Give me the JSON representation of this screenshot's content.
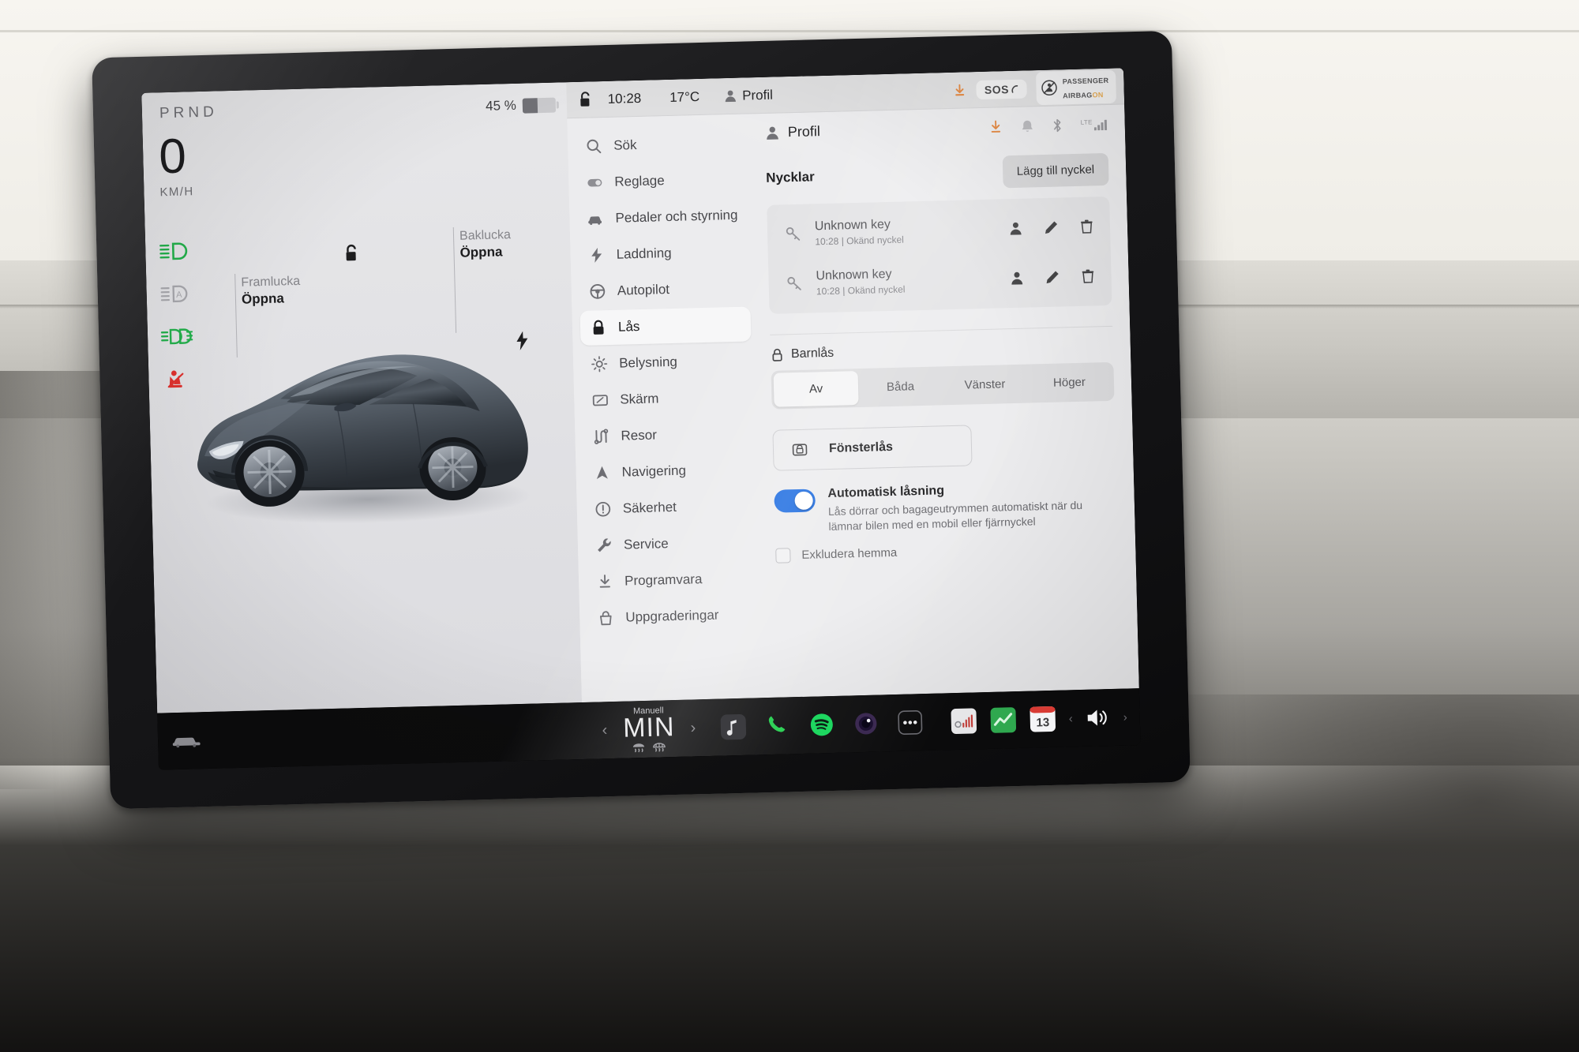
{
  "drive": {
    "gear_indicator": "PRND",
    "speed_value": "0",
    "speed_unit": "KM/H",
    "battery_percent": "45 %",
    "battery_level": 45,
    "telltales": [
      {
        "name": "low-beam-headlight-icon",
        "color": "#23b14c",
        "state": "on"
      },
      {
        "name": "auto-headlight-icon",
        "color": "#a8a8ad",
        "state": "off"
      },
      {
        "name": "fog-light-icon",
        "color": "#23b14c",
        "state": "on"
      },
      {
        "name": "seatbelt-warning-icon",
        "color": "#e0322f",
        "state": "on"
      }
    ],
    "frunk": {
      "title": "Framlucka",
      "action": "Öppna"
    },
    "trunk": {
      "title": "Baklucka",
      "action": "Öppna"
    }
  },
  "status_bar": {
    "lock_icon": "unlocked-padlock-icon",
    "time": "10:28",
    "temperature": "17°C",
    "profile": "Profil",
    "sos_label": "SOS",
    "airbag_line1": "PASSENGER",
    "airbag_line2": "AIRBAG",
    "airbag_state": "ON"
  },
  "profile_row": {
    "name": "Profil",
    "icons": [
      "download-icon",
      "bell-icon",
      "bluetooth-icon",
      "lte-signal-icon"
    ],
    "download_color": "#e2741f",
    "network_label": "LTE"
  },
  "sidebar": {
    "items": [
      {
        "label": "Sök",
        "icon": "search-icon",
        "selected": false
      },
      {
        "label": "Reglage",
        "icon": "toggle-icon",
        "selected": false
      },
      {
        "label": "Pedaler och styrning",
        "icon": "car-icon",
        "selected": false
      },
      {
        "label": "Laddning",
        "icon": "bolt-icon",
        "selected": false
      },
      {
        "label": "Autopilot",
        "icon": "steering-wheel-icon",
        "selected": false
      },
      {
        "label": "Lås",
        "icon": "lock-icon",
        "selected": true
      },
      {
        "label": "Belysning",
        "icon": "brightness-icon",
        "selected": false
      },
      {
        "label": "Skärm",
        "icon": "display-icon",
        "selected": false
      },
      {
        "label": "Resor",
        "icon": "route-icon",
        "selected": false
      },
      {
        "label": "Navigering",
        "icon": "navigation-arrow-icon",
        "selected": false
      },
      {
        "label": "Säkerhet",
        "icon": "alert-circle-icon",
        "selected": false
      },
      {
        "label": "Service",
        "icon": "wrench-icon",
        "selected": false
      },
      {
        "label": "Programvara",
        "icon": "download-icon",
        "selected": false
      },
      {
        "label": "Uppgraderingar",
        "icon": "bag-icon",
        "selected": false
      }
    ]
  },
  "keys": {
    "title": "Nycklar",
    "add_button": "Lägg till nyckel",
    "rows": [
      {
        "name": "Unknown key",
        "detail": "10:28 | Okänd nyckel",
        "actions": [
          "assign-driver-icon",
          "edit-icon",
          "delete-icon"
        ]
      },
      {
        "name": "Unknown key",
        "detail": "10:28 | Okänd nyckel",
        "actions": [
          "assign-driver-icon",
          "edit-icon",
          "delete-icon"
        ]
      }
    ]
  },
  "child_lock": {
    "title": "Barnlås",
    "options": [
      "Av",
      "Båda",
      "Vänster",
      "Höger"
    ],
    "selected": "Av"
  },
  "window_lock": {
    "label": "Fönsterlås",
    "icon": "window-lock-icon"
  },
  "auto_lock": {
    "title": "Automatisk låsning",
    "description": "Lås dörrar och bagageutrymmen automatiskt när du lämnar bilen med en mobil eller fjärrnyckel",
    "enabled": true,
    "accent": "#1a6ae0",
    "exclude_label": "Exkludera hemma",
    "exclude_checked": false
  },
  "dock": {
    "climate_mode": "Manuell",
    "climate_temp": "MIN",
    "car_icon": "car-icon",
    "apps": [
      "music-icon",
      "phone-icon",
      "spotify-icon",
      "camera-icon",
      "more-apps-icon"
    ],
    "tray": [
      "equalizer-icon",
      "stocks-icon",
      "calendar-icon"
    ],
    "calendar_day": "13",
    "volume_icon": "volume-icon"
  }
}
